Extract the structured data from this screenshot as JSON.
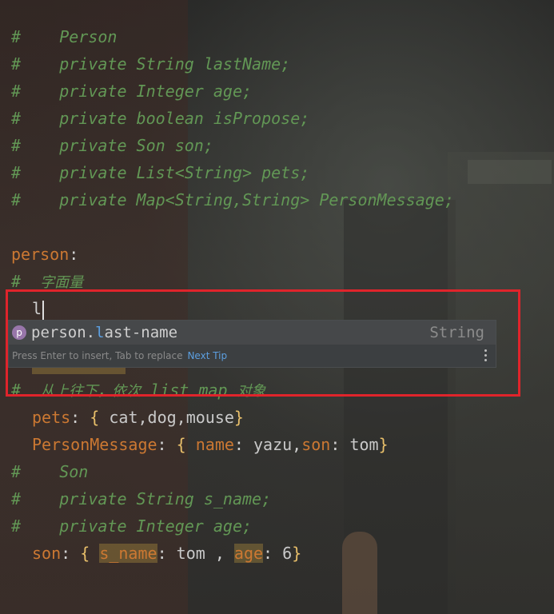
{
  "code": {
    "c1": "#    Person",
    "c2": "#    private String lastName;",
    "c3": "#    private Integer age;",
    "c4": "#    private boolean isPropose;",
    "c5": "#    private Son son;",
    "c6": "#    private List<String> pets;",
    "c7": "#    private Map<String,String> PersonMessage;",
    "person_key": "person",
    "colon": ":",
    "c8_hash": "#",
    "c8_text": "字面量",
    "typed": "l",
    "c9_hash": "#",
    "c9_a": "从上往下，依次",
    "c9_b": "list map",
    "c9_c": "对象",
    "pets_key": "pets",
    "pets_val": "cat,dog,mouse",
    "pm_key": "PersonMessage",
    "pm_name_key": "name",
    "pm_name_val": "yazu",
    "pm_son_key": "son",
    "pm_son_val": "tom",
    "c10": "#    Son",
    "c11": "#    private String s_name;",
    "c12": "#    private Integer age;",
    "son_key": "son",
    "son_sname_key": "s_name",
    "son_sname_val": "tom",
    "son_age_key": "age",
    "son_age_val": "6",
    "lbrace": "{",
    "rbrace": "}",
    "comma": ","
  },
  "completion": {
    "badge": "p",
    "prefix": "person.",
    "match": "l",
    "rest": "ast-name",
    "type": "String",
    "hint": "Press Enter to insert, Tab to replace",
    "tip": "Next Tip"
  },
  "colors": {
    "comment": "#629755",
    "key": "#cc7832",
    "highlight_box": "#e0242b",
    "match": "#5c9fe0"
  }
}
